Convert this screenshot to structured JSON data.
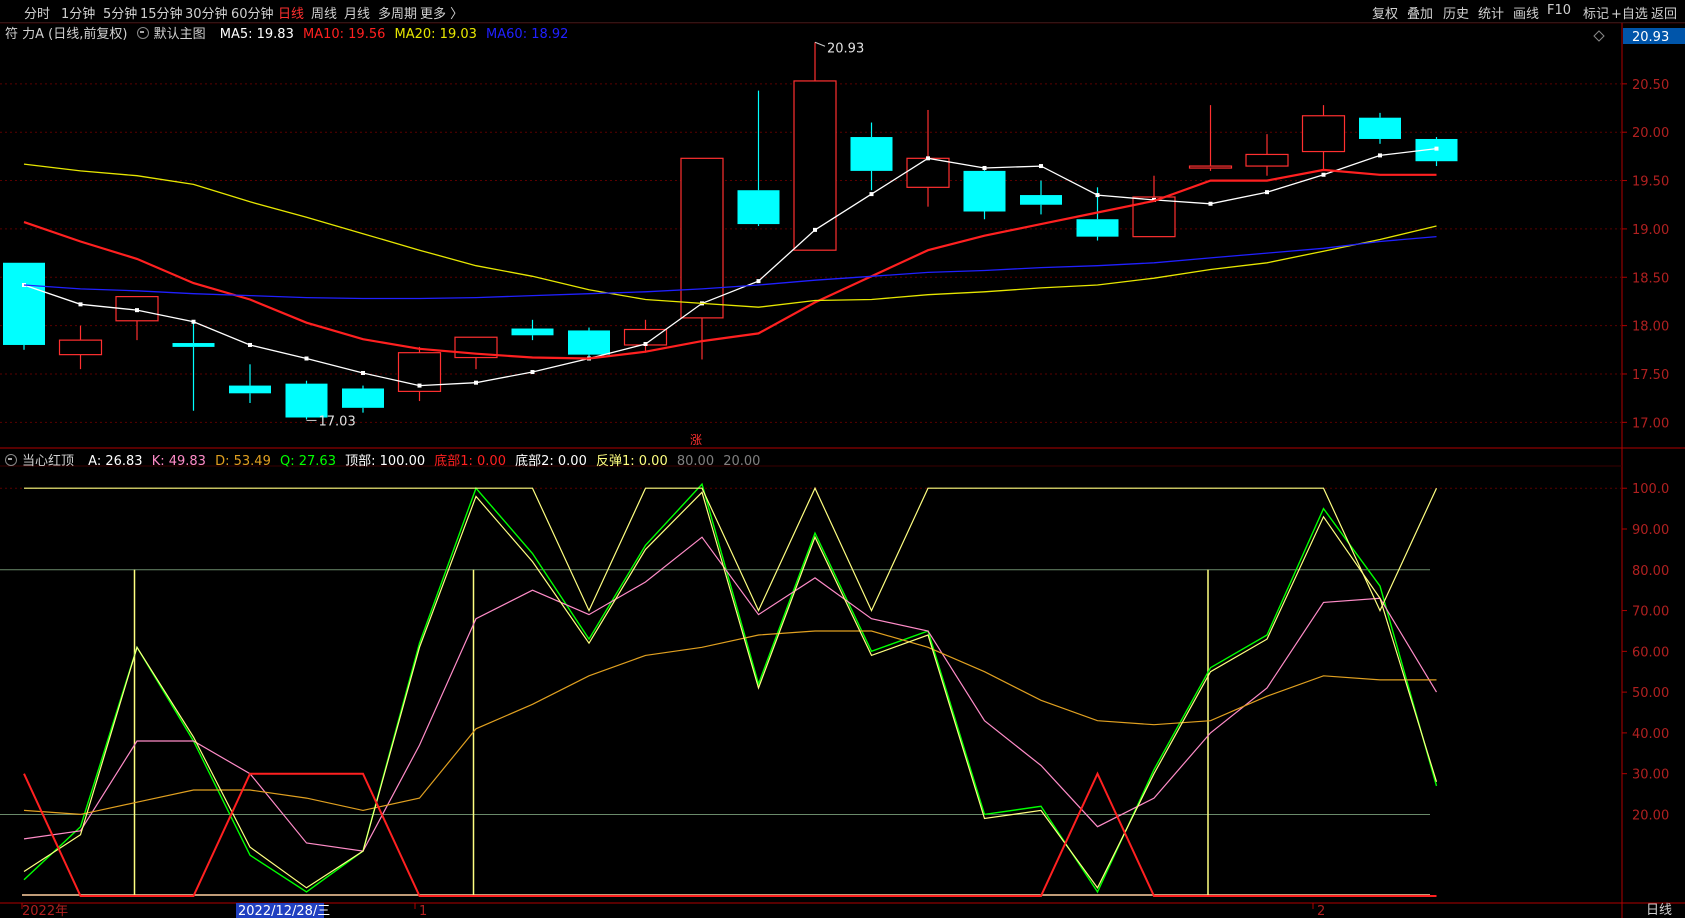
{
  "toolbar": {
    "periods": [
      "分时",
      "1分钟",
      "5分钟",
      "15分钟",
      "30分钟",
      "60分钟",
      "日线",
      "周线",
      "月线",
      "多周期",
      "更多 〉"
    ],
    "active_period": "日线",
    "right_buttons": [
      "复权",
      "叠加",
      "历史",
      "统计",
      "画线",
      "F10",
      "标记",
      "+自选",
      "返回"
    ]
  },
  "main_info": {
    "stock": "符 力A (日线,前复权)",
    "template": "默认主图",
    "ma5_label": "MA5: 19.83",
    "ma10_label": "MA10: 19.56",
    "ma20_label": "MA20: 19.03",
    "ma60_label": "MA60: 18.92",
    "price_tag": "20.93",
    "zhang_tag": "涨"
  },
  "sub_info": {
    "name": "当心红顶",
    "a_label": "A: 26.83",
    "k_label": "K: 49.83",
    "d_label": "D: 53.49",
    "q_label": "Q: 27.63",
    "top_label": "顶部: 100.00",
    "bottom1_label": "底部1: 0.00",
    "bottom2_label": "底部2: 0.00",
    "rebound_label": "反弹1: 0.00",
    "lvl80_label": "80.00",
    "lvl20_label": "20.00"
  },
  "footer": {
    "year_label": "2022年",
    "date_tag": "2022/12/28/三",
    "tick_1": "1",
    "tick_2": "2",
    "period_tab": "日线"
  },
  "colors": {
    "up": "#ff3030",
    "down": "#00ffff",
    "ma5": "#ffffff",
    "ma10": "#ff2020",
    "ma20": "#e6e600",
    "ma60": "#2020ff",
    "k": "#ff8cc8",
    "d": "#e0a020",
    "a": "#00ff00",
    "q": "#ffff80",
    "top": "#ffff80",
    "bottom": "#ff2020"
  },
  "chart_data": [
    {
      "type": "candlestick",
      "title": "符 力A (日线,前复权)",
      "ylim": [
        16.9,
        20.85
      ],
      "y_ticks": [
        17.0,
        17.5,
        18.0,
        18.5,
        19.0,
        19.5,
        20.0,
        20.5
      ],
      "y_tick_labels": [
        "17.00",
        "17.50",
        "18.00",
        "18.50",
        "19.00",
        "19.50",
        "20.00",
        "20.50"
      ],
      "max_label": "20.93",
      "min_label": "17.03",
      "candles": [
        {
          "o": 18.65,
          "c": 17.8,
          "h": 18.65,
          "l": 17.75
        },
        {
          "o": 17.7,
          "c": 17.85,
          "h": 18.0,
          "l": 17.55
        },
        {
          "o": 18.05,
          "c": 18.3,
          "h": 18.3,
          "l": 17.85
        },
        {
          "o": 17.82,
          "c": 17.78,
          "h": 18.05,
          "l": 17.12
        },
        {
          "o": 17.38,
          "c": 17.3,
          "h": 17.6,
          "l": 17.2
        },
        {
          "o": 17.4,
          "c": 17.05,
          "h": 17.43,
          "l": 17.03
        },
        {
          "o": 17.35,
          "c": 17.15,
          "h": 17.38,
          "l": 17.1
        },
        {
          "o": 17.32,
          "c": 17.72,
          "h": 17.78,
          "l": 17.22
        },
        {
          "o": 17.67,
          "c": 17.88,
          "h": 17.88,
          "l": 17.55
        },
        {
          "o": 17.97,
          "c": 17.9,
          "h": 18.06,
          "l": 17.85
        },
        {
          "o": 17.95,
          "c": 17.7,
          "h": 17.98,
          "l": 17.65
        },
        {
          "o": 17.8,
          "c": 17.96,
          "h": 18.06,
          "l": 17.72
        },
        {
          "o": 18.08,
          "c": 19.73,
          "h": 19.73,
          "l": 17.65
        },
        {
          "o": 19.4,
          "c": 19.05,
          "h": 20.43,
          "l": 19.03
        },
        {
          "o": 18.78,
          "c": 20.53,
          "h": 20.93,
          "l": 18.78
        },
        {
          "o": 19.95,
          "c": 19.6,
          "h": 20.1,
          "l": 19.4
        },
        {
          "o": 19.43,
          "c": 19.73,
          "h": 20.23,
          "l": 19.23
        },
        {
          "o": 19.6,
          "c": 19.18,
          "h": 19.62,
          "l": 19.1
        },
        {
          "o": 19.35,
          "c": 19.25,
          "h": 19.5,
          "l": 19.15
        },
        {
          "o": 19.1,
          "c": 18.92,
          "h": 19.43,
          "l": 18.88
        },
        {
          "o": 18.92,
          "c": 19.33,
          "h": 19.55,
          "l": 18.92
        },
        {
          "o": 19.63,
          "c": 19.65,
          "h": 20.28,
          "l": 19.6
        },
        {
          "o": 19.65,
          "c": 19.77,
          "h": 19.98,
          "l": 19.55
        },
        {
          "o": 19.8,
          "c": 20.17,
          "h": 20.28,
          "l": 19.62
        },
        {
          "o": 20.15,
          "c": 19.93,
          "h": 20.2,
          "l": 19.88
        },
        {
          "o": 19.93,
          "c": 19.7,
          "h": 19.95,
          "l": 19.65
        }
      ],
      "series": [
        {
          "name": "MA5",
          "values": [
            18.42,
            18.22,
            18.16,
            18.04,
            17.8,
            17.66,
            17.51,
            17.38,
            17.41,
            17.52,
            17.66,
            17.81,
            18.23,
            18.46,
            18.99,
            19.36,
            19.73,
            19.63,
            19.65,
            19.35,
            19.3,
            19.26,
            19.38,
            19.56,
            19.76,
            19.83
          ]
        },
        {
          "name": "MA10",
          "values": [
            19.07,
            18.87,
            18.69,
            18.44,
            18.27,
            18.03,
            17.86,
            17.76,
            17.71,
            17.67,
            17.66,
            17.73,
            17.84,
            17.92,
            18.24,
            18.51,
            18.78,
            18.93,
            19.05,
            19.17,
            19.29,
            19.5,
            19.5,
            19.61,
            19.56,
            19.56
          ]
        },
        {
          "name": "MA20",
          "values": [
            19.67,
            19.6,
            19.55,
            19.46,
            19.28,
            19.12,
            18.95,
            18.78,
            18.62,
            18.51,
            18.37,
            18.27,
            18.23,
            18.19,
            18.26,
            18.27,
            18.32,
            18.35,
            18.39,
            18.42,
            18.49,
            18.58,
            18.65,
            18.77,
            18.89,
            19.03
          ]
        },
        {
          "name": "MA60",
          "values": [
            18.42,
            18.38,
            18.36,
            18.33,
            18.31,
            18.29,
            18.28,
            18.28,
            18.29,
            18.31,
            18.33,
            18.35,
            18.38,
            18.42,
            18.47,
            18.51,
            18.55,
            18.57,
            18.6,
            18.62,
            18.65,
            18.7,
            18.75,
            18.8,
            18.87,
            18.92
          ]
        }
      ]
    },
    {
      "type": "line",
      "title": "当心红顶",
      "ylim": [
        0,
        103
      ],
      "y_ticks": [
        20,
        30,
        40,
        50,
        60,
        70,
        80,
        90,
        100
      ],
      "y_tick_labels": [
        "20.00",
        "30.00",
        "40.00",
        "50.00",
        "60.00",
        "70.00",
        "80.00",
        "90.00",
        "100.0"
      ],
      "reference_levels": [
        80,
        20
      ],
      "series": [
        {
          "name": "A",
          "values": [
            4,
            17,
            61,
            38,
            10,
            1,
            11,
            62,
            100,
            84,
            63,
            86,
            101,
            52,
            89,
            60,
            65,
            20,
            22,
            1,
            31,
            56,
            64,
            95,
            76,
            27
          ]
        },
        {
          "name": "K",
          "values": [
            14,
            16,
            38,
            38,
            30,
            13,
            11,
            37,
            68,
            75,
            69,
            77,
            88,
            69,
            78,
            68,
            65,
            43,
            32,
            17,
            24,
            40,
            51,
            72,
            73,
            50
          ]
        },
        {
          "name": "D",
          "values": [
            21,
            20,
            23,
            26,
            26,
            24,
            21,
            24,
            41,
            47,
            54,
            59,
            61,
            64,
            65,
            65,
            61,
            55,
            48,
            43,
            42,
            43,
            49,
            54,
            53,
            53
          ]
        },
        {
          "name": "Q",
          "values": [
            6,
            15,
            61,
            39,
            12,
            2,
            11,
            61,
            98,
            82,
            62,
            85,
            99,
            51,
            88,
            59,
            64,
            19,
            21,
            2,
            30,
            55,
            63,
            93,
            73,
            28
          ]
        },
        {
          "name": "顶部",
          "values": [
            100,
            100,
            100,
            100,
            100,
            100,
            100,
            100,
            100,
            100,
            70,
            100,
            100,
            70,
            100,
            70,
            100,
            100,
            100,
            100,
            100,
            100,
            100,
            100,
            70,
            100
          ]
        },
        {
          "name": "底部1",
          "values": [
            30,
            0,
            0,
            0,
            30,
            30,
            30,
            0,
            0,
            0,
            0,
            0,
            0,
            0,
            0,
            0,
            0,
            0,
            0,
            30,
            0,
            0,
            0,
            0,
            0,
            0
          ]
        }
      ],
      "signals_x_index": [
        1,
        7,
        20
      ]
    }
  ]
}
